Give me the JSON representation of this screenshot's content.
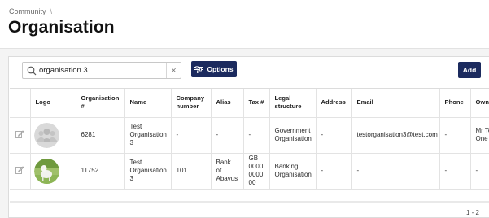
{
  "breadcrumb": {
    "items": [
      "Community"
    ],
    "separator": "\\"
  },
  "page_title": "Organisation",
  "toolbar": {
    "search_value": "organisation 3",
    "clear_label": "×",
    "options_label": "Options",
    "add_label": "Add"
  },
  "table": {
    "headers": [
      "",
      "Logo",
      "Organisation #",
      "Name",
      "Company number",
      "Alias",
      "Tax #",
      "Legal structure",
      "Address",
      "Email",
      "Phone",
      "Owner"
    ],
    "rows": [
      {
        "logo": "default-avatar-icon",
        "org_number": "6281",
        "name": "Test Organisation 3",
        "company_number": "-",
        "alias": "-",
        "tax": "-",
        "legal_structure": "Government Organisation",
        "address": "-",
        "email": "testorganisation3@test.com",
        "phone": "-",
        "owner": "Mr Test One"
      },
      {
        "logo": "goat-photo",
        "org_number": "11752",
        "name": "Test Organisation 3",
        "company_number": "101",
        "alias": "Bank of Abavus",
        "tax": "GB 0000 0000 00",
        "legal_structure": "Banking Organisation",
        "address": "-",
        "email": "-",
        "phone": "-",
        "owner": "-"
      }
    ]
  },
  "pagination": "1 - 2",
  "colors": {
    "primary_button": "#1b2a5e",
    "background": "#f4f4f4"
  }
}
